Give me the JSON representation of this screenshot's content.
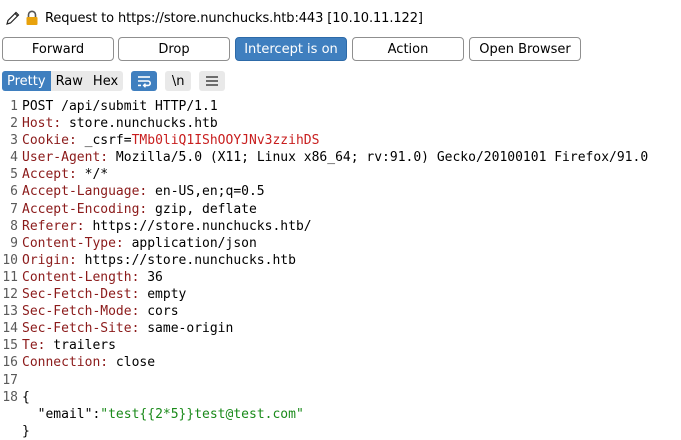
{
  "titlebar": {
    "title": "Request to https://store.nunchucks.htb:443  [10.10.11.122]"
  },
  "buttons": {
    "forward": "Forward",
    "drop": "Drop",
    "intercept": "Intercept is on",
    "action": "Action",
    "open_browser": "Open Browser"
  },
  "view_tabs": {
    "pretty": "Pretty",
    "raw": "Raw",
    "hex": "Hex",
    "newline_toggle": "\\n"
  },
  "request": {
    "request_line": "POST /api/submit HTTP/1.1",
    "headers": [
      {
        "name": "Host",
        "value": " store.nunchucks.htb"
      },
      {
        "name": "Cookie",
        "value": " _csrf=",
        "extra": "TMb0liQ1IShOOYJNv3zzihDS"
      },
      {
        "name": "User-Agent",
        "value": " Mozilla/5.0 (X11; Linux x86_64; rv:91.0) Gecko/20100101 Firefox/91.0"
      },
      {
        "name": "Accept",
        "value": " */*"
      },
      {
        "name": "Accept-Language",
        "value": " en-US,en;q=0.5"
      },
      {
        "name": "Accept-Encoding",
        "value": " gzip, deflate"
      },
      {
        "name": "Referer",
        "value": " https://store.nunchucks.htb/"
      },
      {
        "name": "Content-Type",
        "value": " application/json"
      },
      {
        "name": "Origin",
        "value": " https://store.nunchucks.htb"
      },
      {
        "name": "Content-Length",
        "value": " 36"
      },
      {
        "name": "Sec-Fetch-Dest",
        "value": " empty"
      },
      {
        "name": "Sec-Fetch-Mode",
        "value": " cors"
      },
      {
        "name": "Sec-Fetch-Site",
        "value": " same-origin"
      },
      {
        "name": "Te",
        "value": " trailers"
      },
      {
        "name": "Connection",
        "value": " close"
      }
    ],
    "body_open": "{",
    "json_key": "  \"email\"",
    "json_sep": ":",
    "json_value": "\"test{{2*5}}test@test.com\"",
    "body_close": "}",
    "line_numbers": [
      "1",
      "2",
      "3",
      "4",
      "5",
      "6",
      "7",
      "8",
      "9",
      "10",
      "11",
      "12",
      "13",
      "14",
      "15",
      "16",
      "17",
      "18"
    ]
  }
}
